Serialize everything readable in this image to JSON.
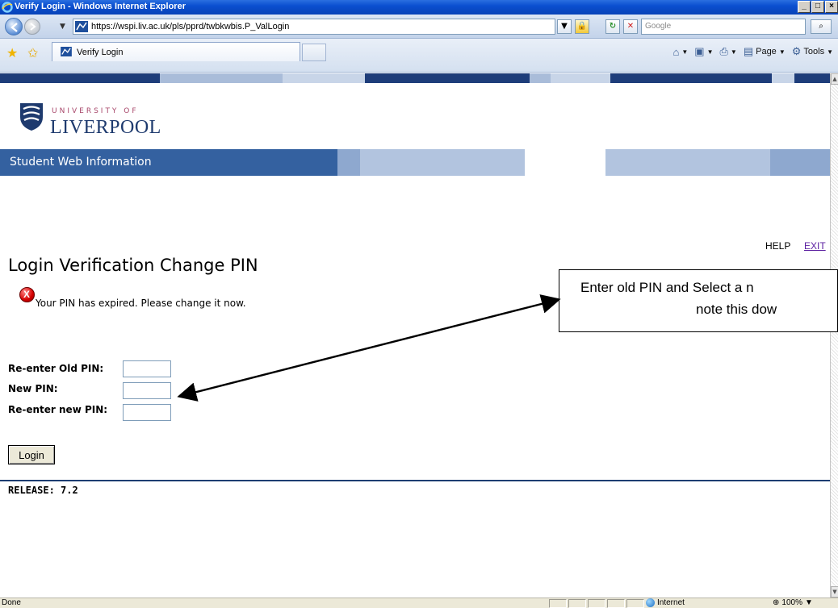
{
  "window": {
    "title": "Verify Login - Windows Internet Explorer",
    "controls": [
      "_",
      "□",
      "×"
    ]
  },
  "address_bar": {
    "url": "https://wspi.liv.ac.uk/pls/pprd/twbkwbis.P_ValLogin",
    "search_placeholder": "Google"
  },
  "tabs": {
    "active_tab_label": "Verify Login"
  },
  "command_bar": {
    "page_label": "Page",
    "tools_label": "Tools"
  },
  "icons": {
    "back": "back-arrow-icon",
    "forward": "forward-arrow-icon",
    "refresh": "refresh-icon",
    "stop": "stop-icon",
    "lock": "lock-icon",
    "search": "search-icon",
    "favorites": "favorites-star-icon",
    "add_favorite": "add-favorite-icon",
    "home": "home-icon",
    "feeds": "feeds-icon",
    "print": "print-icon",
    "error": "error-icon"
  },
  "site": {
    "logo_top": "UNIVERSITY OF",
    "logo_main": "LIVERPOOL",
    "banner_title": "Student Web Information",
    "colors": {
      "banner_blue": "#3461a0",
      "bar_navy": "#1e3d7a",
      "bar_light": "#a9bcd9",
      "bar_pale": "#c8d5e8"
    }
  },
  "page": {
    "help_label": "HELP",
    "exit_label": "EXIT",
    "title": "Login Verification Change PIN",
    "error_message": "Your PIN has expired. Please change it now.",
    "error_glyph": "X",
    "form": {
      "old_pin_label": "Re-enter Old PIN:",
      "new_pin_label": "New PIN:",
      "confirm_pin_label": "Re-enter new PIN:",
      "old_pin_value": "",
      "new_pin_value": "",
      "confirm_pin_value": ""
    },
    "login_button": "Login",
    "release": "RELEASE: 7.2"
  },
  "callout": {
    "line1": "Enter old PIN and Select a n",
    "line2": "note this dow"
  },
  "status_bar": {
    "text": "Done",
    "zone": "Internet",
    "zoom": "100%"
  }
}
